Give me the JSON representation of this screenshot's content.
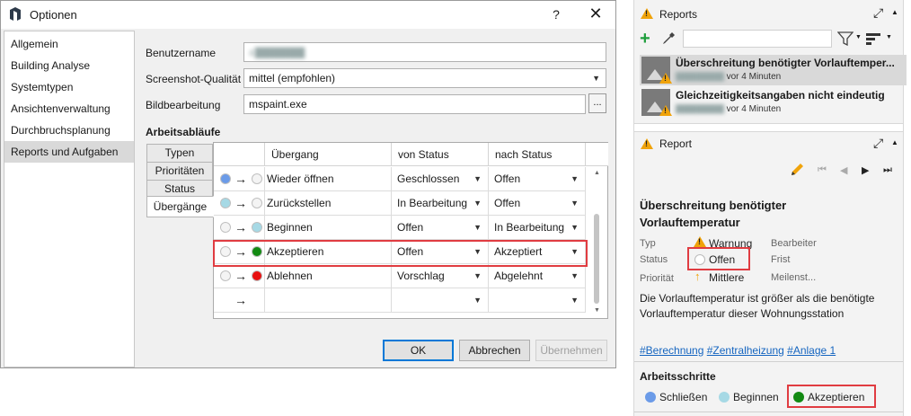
{
  "dialog": {
    "title": "Optionen",
    "help": "?",
    "close": "✕",
    "nav": [
      "Allgemein",
      "Building Analyse",
      "Systemtypen",
      "Ansichtenverwaltung",
      "Durchbruchsplanung",
      "Reports und Aufgaben"
    ],
    "fields": {
      "username_label": "Benutzername",
      "username_value": "a",
      "quality_label": "Screenshot-Qualität",
      "quality_value": "mittel (empfohlen)",
      "editor_label": "Bildbearbeitung",
      "editor_value": "mspaint.exe",
      "browse": "..."
    },
    "section_title": "Arbeitsabläufe",
    "tabs": [
      "Typen",
      "Prioritäten",
      "Status",
      "Übergänge"
    ],
    "table": {
      "headers": [
        "Übergang",
        "von Status",
        "nach Status"
      ],
      "arrow": "→",
      "rows": [
        {
          "name": "Wieder öffnen",
          "from": "Geschlossen",
          "to": "Offen",
          "c1": "#6b9be8",
          "c2": "#f4f4f4"
        },
        {
          "name": "Zurückstellen",
          "from": "In Bearbeitung",
          "to": "Offen",
          "c1": "#a6d9e5",
          "c2": "#f4f4f4"
        },
        {
          "name": "Beginnen",
          "from": "Offen",
          "to": "In Bearbeitung",
          "c1": "#f4f4f4",
          "c2": "#a6d9e5"
        },
        {
          "name": "Akzeptieren",
          "from": "Offen",
          "to": "Akzeptiert",
          "c1": "#f4f4f4",
          "c2": "#138a13"
        },
        {
          "name": "Ablehnen",
          "from": "Vorschlag",
          "to": "Abgelehnt",
          "c1": "#f4f4f4",
          "c2": "#e81010"
        },
        {
          "name": "",
          "from": "",
          "to": "",
          "c1": "",
          "c2": ""
        }
      ]
    },
    "buttons": {
      "ok": "OK",
      "cancel": "Abbrechen",
      "apply": "Übernehmen"
    }
  },
  "reports_panel": {
    "title": "Reports",
    "items": [
      {
        "title": "Überschreitung benötigter Vorlauftemper...",
        "time": "vor 4 Minuten"
      },
      {
        "title": "Gleichzeitigkeitsangaben nicht eindeutig",
        "time": "vor 4 Minuten"
      }
    ]
  },
  "report_panel": {
    "title": "Report",
    "heading_line1": "Überschreitung benötigter",
    "heading_line2": "Vorlauftemperatur",
    "type_label": "Typ",
    "type_value": "Warnung",
    "status_label": "Status",
    "status_value": "Offen",
    "priority_label": "Priorität",
    "priority_value": "Mittlere",
    "assignee_label": "Bearbeiter",
    "deadline_label": "Frist",
    "milestone_label": "Meilenst...",
    "description_line1": "Die Vorlauftemperatur ist größer als die benötigte",
    "description_line2": "Vorlauftemperatur dieser Wohnungsstation",
    "tags": [
      "#Berechnung",
      "#Zentralheizung",
      "#Anlage 1"
    ],
    "steps_title": "Arbeitsschritte",
    "steps": [
      {
        "label": "Schließen",
        "color": "#6b9be8"
      },
      {
        "label": "Beginnen",
        "color": "#a6d9e5"
      },
      {
        "label": "Akzeptieren",
        "color": "#138a13"
      }
    ]
  }
}
